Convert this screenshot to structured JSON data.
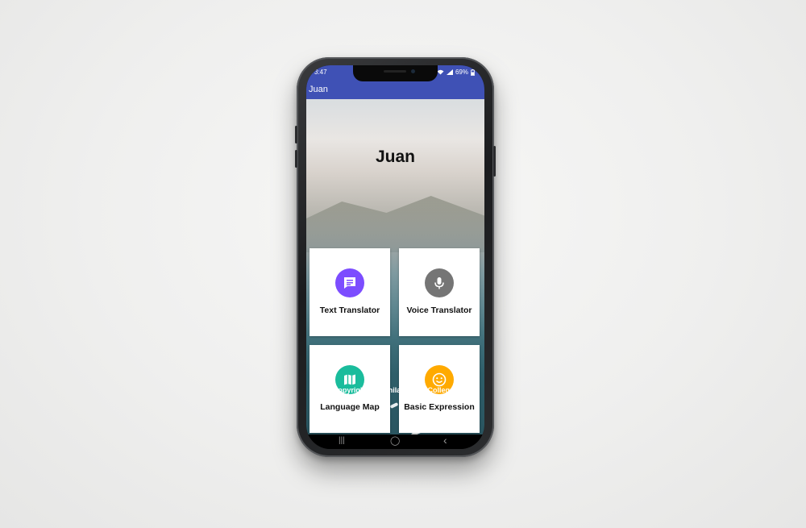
{
  "status_bar": {
    "time": "3:47",
    "battery": "69%"
  },
  "app_bar": {
    "title": "Juan"
  },
  "main": {
    "title": "Juan",
    "menu": [
      {
        "label": "Text Translator",
        "icon": "chat-message-icon",
        "color": "#7c4dff"
      },
      {
        "label": "Voice Translator",
        "icon": "microphone-icon",
        "color": "#757575"
      },
      {
        "label": "Language Map",
        "icon": "map-icon",
        "color": "#1abc9c"
      },
      {
        "label": "Basic Expression",
        "icon": "smiley-face-icon",
        "color": "#ffaa00"
      }
    ],
    "copyright": "Copyright @ Manila Tytana Colleges"
  },
  "nav_bar": {
    "recents": "|||",
    "home": "◯",
    "back": "‹"
  },
  "colors": {
    "primary": "#3f51b5"
  }
}
